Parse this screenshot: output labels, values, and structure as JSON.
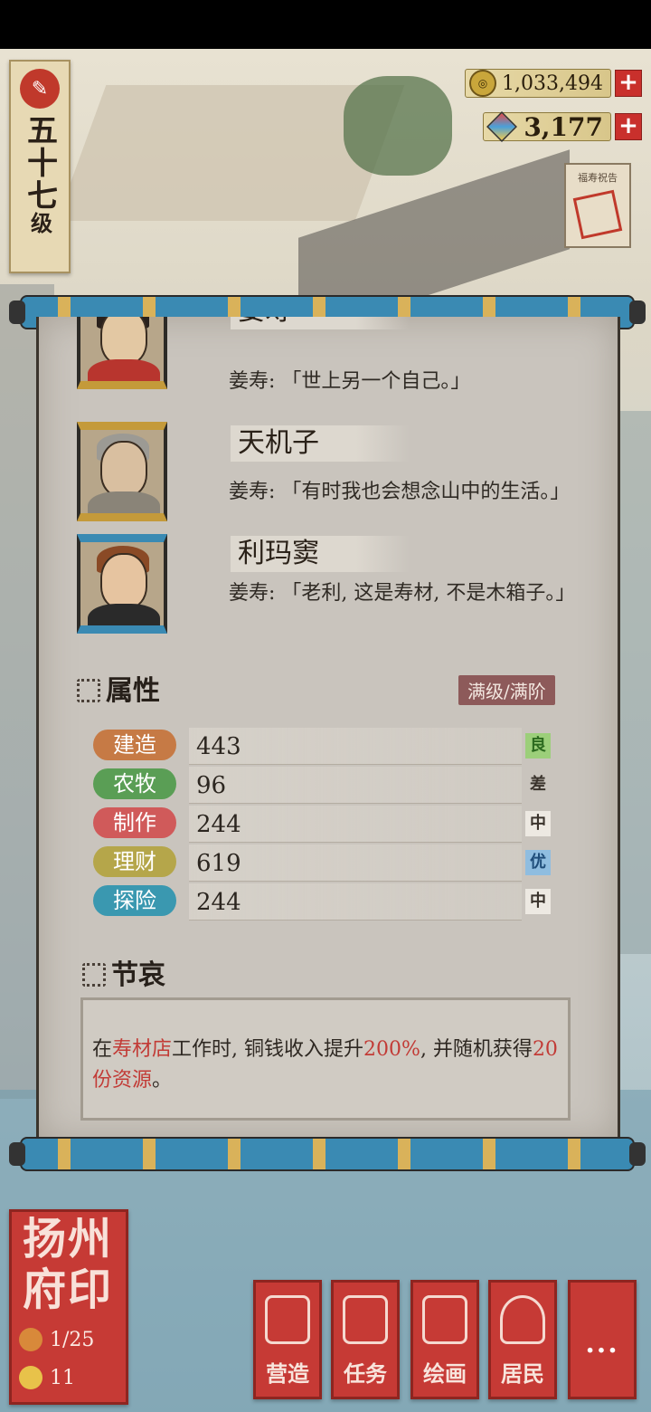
{
  "level": {
    "text_main": "五十七",
    "text_unit": "级"
  },
  "currency": {
    "coins": "1,033,494",
    "gems": "3,177",
    "plus": "+"
  },
  "notice_board": {
    "label": "福寿祝告"
  },
  "residents": [
    {
      "name": "姜寿",
      "quote": "姜寿: 「世上另一个自己。」"
    },
    {
      "name": "天机子",
      "quote": "姜寿: 「有时我也会想念山中的生活。」"
    },
    {
      "name": "利玛窦",
      "quote": "姜寿: 「老利, 这是寿材, 不是木箱子。」"
    }
  ],
  "attributes": {
    "title": "属性",
    "badge": "满级/满阶",
    "rows": [
      {
        "label": "建造",
        "value": "443",
        "grade": "良",
        "label_color": "#c67a45",
        "grade_bg": "#9ccf7a"
      },
      {
        "label": "农牧",
        "value": "96",
        "grade": "差",
        "label_color": "#5a9e55",
        "grade_bg": "transparent"
      },
      {
        "label": "制作",
        "value": "244",
        "grade": "中",
        "label_color": "#d05a5a",
        "grade_bg": "#e8e4dc"
      },
      {
        "label": "理财",
        "value": "619",
        "grade": "优",
        "label_color": "#b5a64a",
        "grade_bg": "#8fbde0"
      },
      {
        "label": "探险",
        "value": "244",
        "grade": "中",
        "label_color": "#3a98b0",
        "grade_bg": "#e8e4dc"
      }
    ]
  },
  "skill": {
    "title": "节哀",
    "parts": {
      "p1": "在",
      "shop": "寿材店",
      "p2": "工作时, 铜钱收入提升",
      "pct": "200%",
      "p3": ", 并随机获得",
      "amt": "20份资源",
      "p4": "。"
    }
  },
  "seal": {
    "title": "扬州府印",
    "stat1": "1/25",
    "stat2": "11"
  },
  "bottom_nav": [
    {
      "label": "营造"
    },
    {
      "label": "任务"
    },
    {
      "label": "绘画"
    },
    {
      "label": "居民"
    },
    {
      "label": "..."
    }
  ]
}
